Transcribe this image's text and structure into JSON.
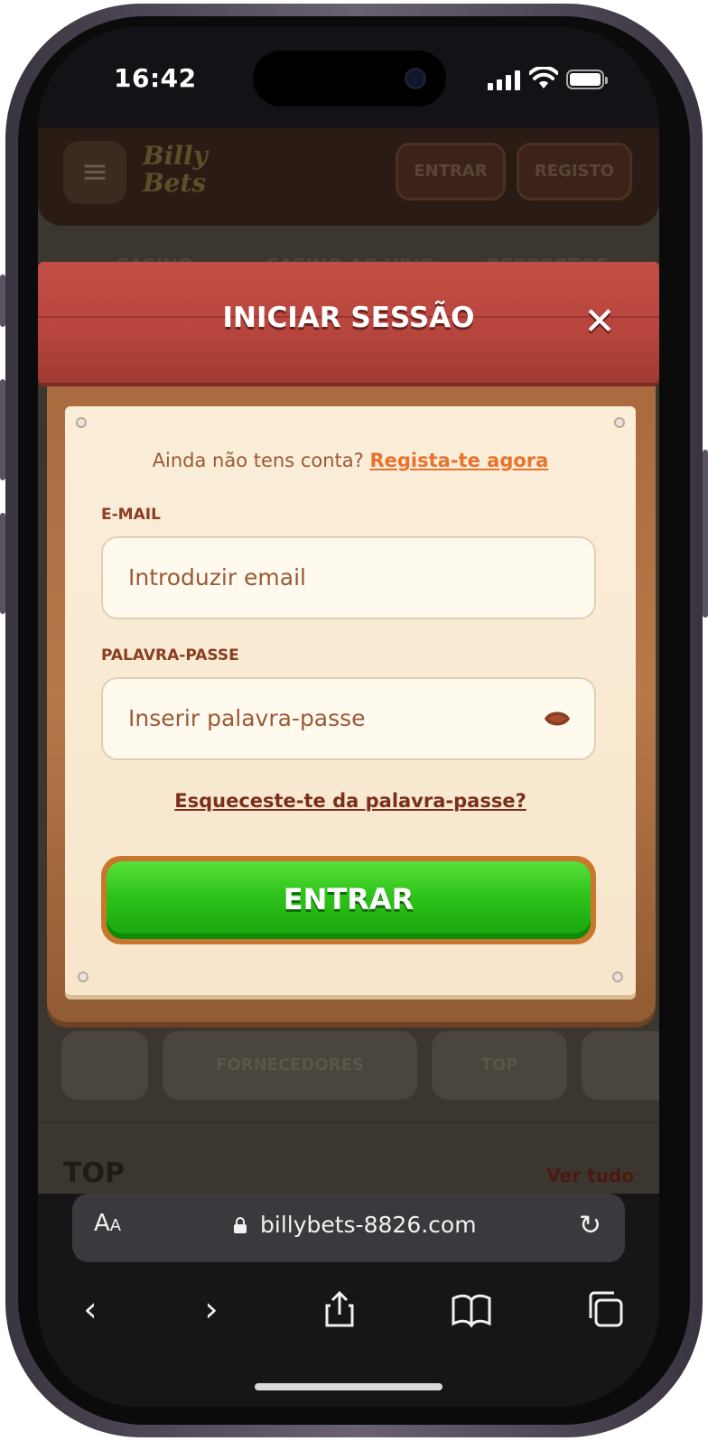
{
  "status": {
    "time": "16:42"
  },
  "site": {
    "logo_text": "Billy Bets",
    "menu_icon": "hamburger-icon",
    "header_login": "ENTRAR",
    "header_register": "REGISTO",
    "nav": [
      "CASINO",
      "CASINO AO VIVO",
      "DESPORTOS"
    ],
    "pills": [
      "FORNECEDORES",
      "TOP"
    ],
    "section_title": "TOP",
    "see_all": "Ver tudo"
  },
  "modal": {
    "title": "INICIAR SESSÃO",
    "close_icon": "close-icon",
    "no_account": "Ainda não tens conta?",
    "signup_link": "Regista-te agora",
    "email_label": "E-MAIL",
    "email_placeholder": "Introduzir email",
    "password_label": "PALAVRA-PASSE",
    "password_placeholder": "Inserir palavra-passe",
    "eye_icon": "eye-icon",
    "forgot_link": "Esqueceste-te da palavra-passe?",
    "submit": "ENTRAR"
  },
  "browser": {
    "text_size": "AA",
    "url": "billybets-8826.com",
    "icons": [
      "back-icon",
      "forward-icon",
      "share-icon",
      "bookmarks-icon",
      "tabs-icon"
    ]
  },
  "colors": {
    "plank": "#b8463e",
    "button_green": "#2fc21a",
    "link_orange": "#e7732f"
  }
}
